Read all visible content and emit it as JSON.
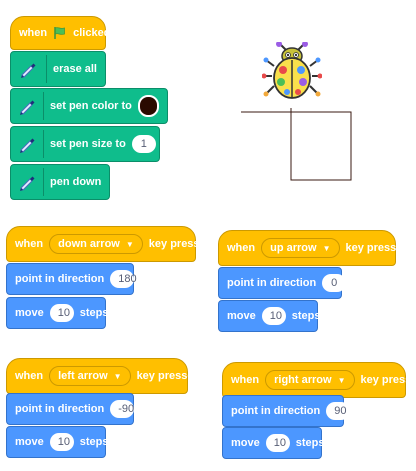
{
  "flag_script": {
    "hat_when": "when",
    "hat_clicked": "clicked",
    "erase_all": "erase all",
    "set_pen_color": "set pen color to",
    "pen_color": "#2a0a00",
    "set_pen_size": "set pen size to",
    "pen_size": "1",
    "pen_down": "pen down"
  },
  "key_scripts": [
    {
      "when": "when",
      "key": "down arrow",
      "key_pressed": "key pressed",
      "point": "point in direction",
      "direction": "180",
      "move": "move",
      "steps_value": "10",
      "steps": "steps"
    },
    {
      "when": "when",
      "key": "up arrow",
      "key_pressed": "key pressed",
      "point": "point in direction",
      "direction": "0",
      "move": "move",
      "steps_value": "10",
      "steps": "steps"
    },
    {
      "when": "when",
      "key": "left arrow",
      "key_pressed": "key pressed",
      "point": "point in direction",
      "direction": "-90",
      "move": "move",
      "steps_value": "10",
      "steps": "steps"
    },
    {
      "when": "when",
      "key": "right arrow",
      "key_pressed": "key pressed",
      "point": "point in direction",
      "direction": "90",
      "move": "move",
      "steps_value": "10",
      "steps": "steps"
    }
  ],
  "colors": {
    "event": "#ffbf00",
    "pen": "#0fbd8c",
    "motion": "#4c97ff",
    "flag": "#4cbf56"
  },
  "icons": {
    "flag": "green-flag-icon",
    "pen": "pen-extension-icon",
    "sprite": "ladybug-sprite"
  }
}
